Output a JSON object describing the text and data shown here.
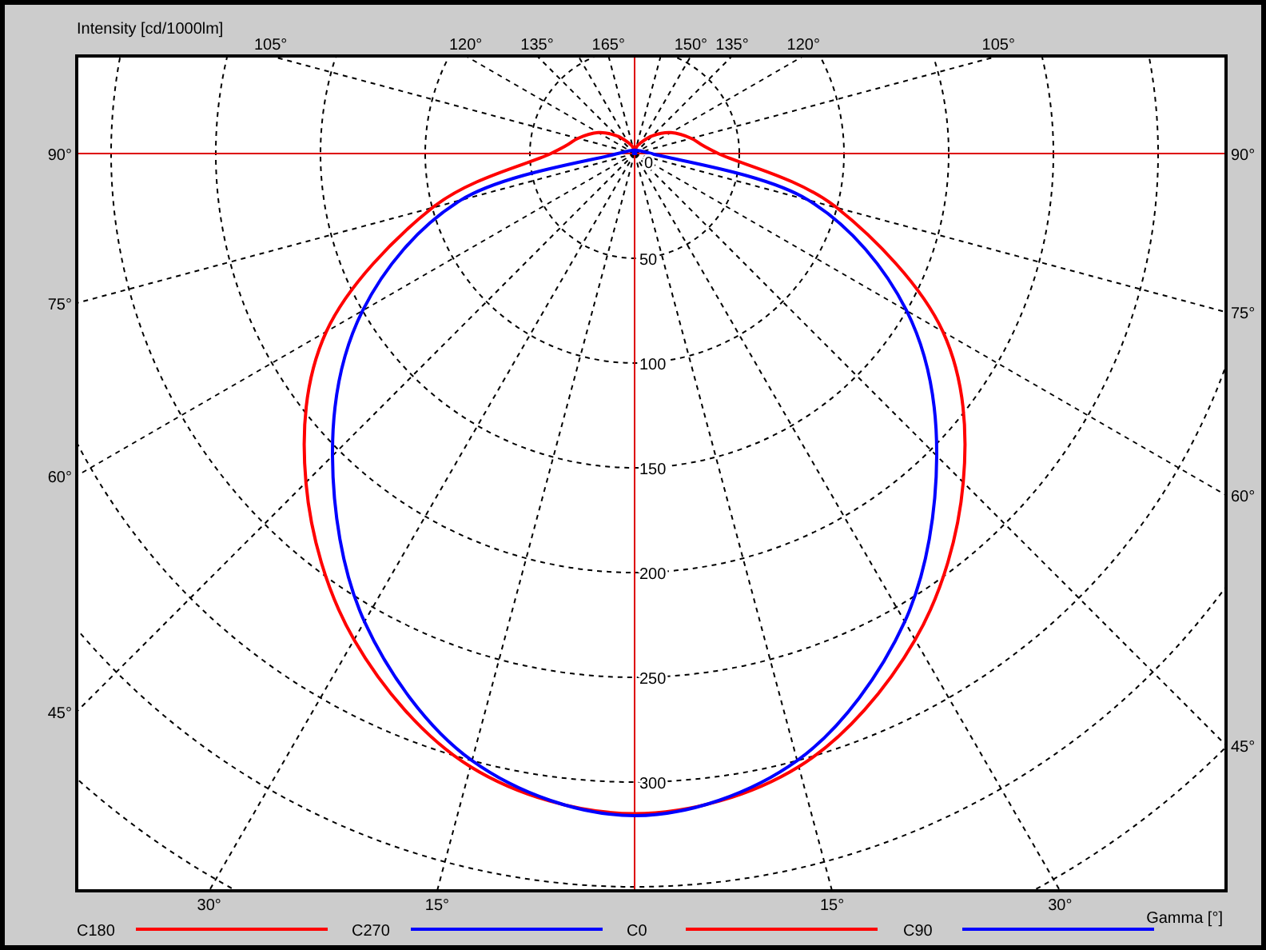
{
  "chart": {
    "y_axis_title": "Intensity [cd/1000lm]",
    "angle_labels": [
      "105°",
      "120°",
      "135°",
      "165°",
      "150°",
      "135°",
      "120°",
      "105°",
      "90°",
      "90°",
      "75°",
      "75°",
      "60°",
      "60°",
      "45°",
      "45°",
      "30°",
      "15°",
      "15°",
      "30°"
    ],
    "intensity_labels": [
      "0",
      "50",
      "100",
      "150",
      "200",
      "250",
      "300"
    ],
    "x_axis_title": "Gamma [°]",
    "legend": [
      {
        "name": "C180",
        "color": "#ff0000"
      },
      {
        "name": "C270",
        "color": "#0000ff"
      },
      {
        "name": "C0",
        "color": "#ff0000"
      },
      {
        "name": "C90",
        "color": "#0000ff"
      }
    ]
  }
}
